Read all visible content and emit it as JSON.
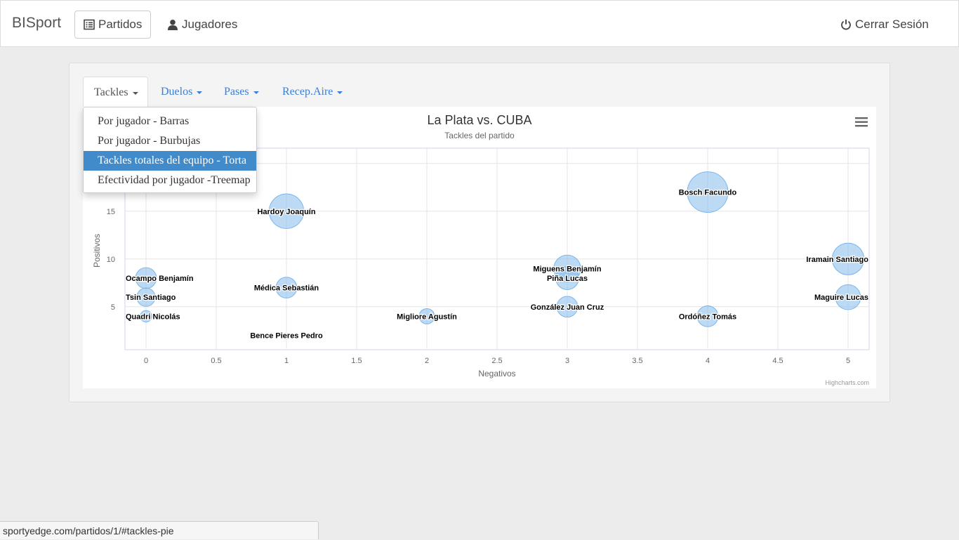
{
  "navbar": {
    "brand": "BISport",
    "partidos": "Partidos",
    "jugadores": "Jugadores",
    "logout": "Cerrar Sesión"
  },
  "tabs": [
    {
      "label": "Tackles"
    },
    {
      "label": "Duelos"
    },
    {
      "label": "Pases"
    },
    {
      "label": "Recep.Aire"
    }
  ],
  "dropdown": {
    "items": [
      "Por jugador - Barras",
      "Por jugador - Burbujas",
      "Tackles totales del equipo - Torta",
      "Efectividad por jugador -Treemap"
    ],
    "selected_index": 2
  },
  "status_url": "sportyedge.com/partidos/1/#tackles-pie",
  "chart_data": {
    "type": "scatter",
    "title": "La Plata vs. CUBA",
    "subtitle": "Tackles del partido",
    "xlabel": "Negativos",
    "ylabel": "Positivos",
    "xticks": [
      "0",
      "0.5",
      "1",
      "1.5",
      "2",
      "2.5",
      "3",
      "3.5",
      "4",
      "4.5",
      "5"
    ],
    "yticks": [
      "5",
      "10",
      "15"
    ],
    "xlim": [
      -0.15,
      5.15
    ],
    "ylim": [
      0.5,
      21.6
    ],
    "grid": true,
    "legend": false,
    "bubble_color": "#7cb5ec",
    "credits": "Highcharts.com",
    "points": [
      {
        "name": "Bosch Facundo",
        "x": 4,
        "y": 17,
        "z": 17
      },
      {
        "name": "Hardoy Joaquín",
        "x": 1,
        "y": 15,
        "z": 12
      },
      {
        "name": "Iramain Santiago",
        "x": 5,
        "y": 10,
        "z": 10
      },
      {
        "name": "Miguens Benjamín",
        "x": 3,
        "y": 9,
        "z": 7
      },
      {
        "name": "Piña Lucas",
        "x": 3,
        "y": 8,
        "z": 5
      },
      {
        "name": "Ocampo Benjamín",
        "x": 0,
        "y": 8,
        "z": 4
      },
      {
        "name": "Médica Sebastián",
        "x": 1,
        "y": 7,
        "z": 4
      },
      {
        "name": "Tsin Santiago",
        "x": 0,
        "y": 6,
        "z": 3
      },
      {
        "name": "Maguire Lucas",
        "x": 5,
        "y": 6,
        "z": 6
      },
      {
        "name": "González Juan Cruz",
        "x": 3,
        "y": 5,
        "z": 4
      },
      {
        "name": "Quadri Nicolás",
        "x": 0,
        "y": 4,
        "z": 1
      },
      {
        "name": "Migliore Agustín",
        "x": 2,
        "y": 4,
        "z": 2
      },
      {
        "name": "Ordóñez Tomás",
        "x": 4,
        "y": 4,
        "z": 4
      },
      {
        "name": "Bence Pieres Pedro",
        "x": 1,
        "y": 2,
        "z": 0
      }
    ]
  }
}
